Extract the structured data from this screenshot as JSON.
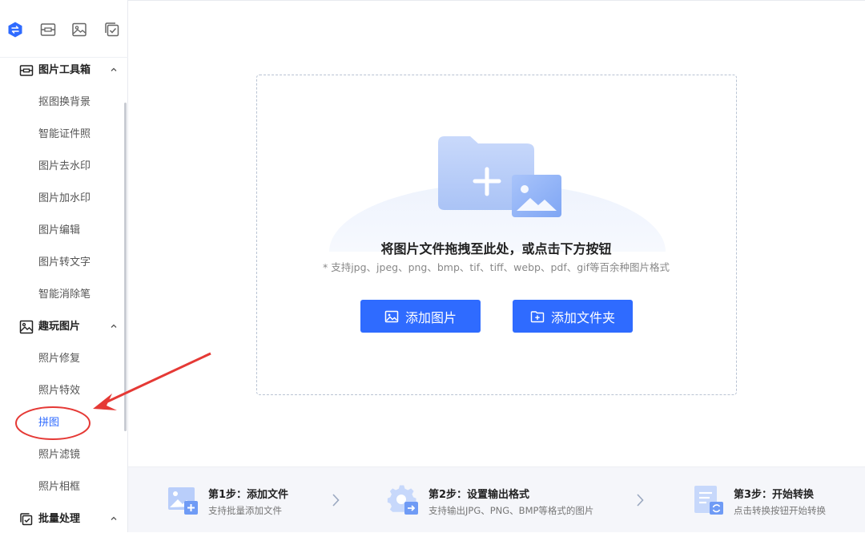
{
  "sidebar": {
    "top_icons": [
      "convert-icon",
      "image-toolbox-icon",
      "picture-icon",
      "batch-check-icon"
    ],
    "groups": [
      {
        "label": "图片工具箱",
        "icon": "image-toolbox-icon",
        "items": [
          "抠图换背景",
          "智能证件照",
          "图片去水印",
          "图片加水印",
          "图片编辑",
          "图片转文字",
          "智能消除笔"
        ]
      },
      {
        "label": "趣玩图片",
        "icon": "picture-icon",
        "items": [
          "照片修复",
          "照片特效",
          "拼图",
          "照片滤镜",
          "照片相框"
        ]
      },
      {
        "label": "批量处理",
        "icon": "batch-check-icon",
        "items": []
      }
    ],
    "active_item": "拼图"
  },
  "dropzone": {
    "title": "将图片文件拖拽至此处，或点击下方按钮",
    "subtitle": "* 支持jpg、jpeg、png、bmp、tif、tiff、webp、pdf、gif等百余种图片格式",
    "add_image_label": "添加图片",
    "add_folder_label": "添加文件夹"
  },
  "steps": [
    {
      "title": "第1步：添加文件",
      "desc": "支持批量添加文件",
      "icon": "add-file-icon"
    },
    {
      "title": "第2步：设置输出格式",
      "desc": "支持输出JPG、PNG、BMP等格式的图片",
      "icon": "settings-gear-icon"
    },
    {
      "title": "第3步：开始转换",
      "desc": "点击转换按钮开始转换",
      "icon": "convert-doc-icon"
    }
  ],
  "colors": {
    "accent": "#2f6bff",
    "annotation": "#e53935"
  }
}
